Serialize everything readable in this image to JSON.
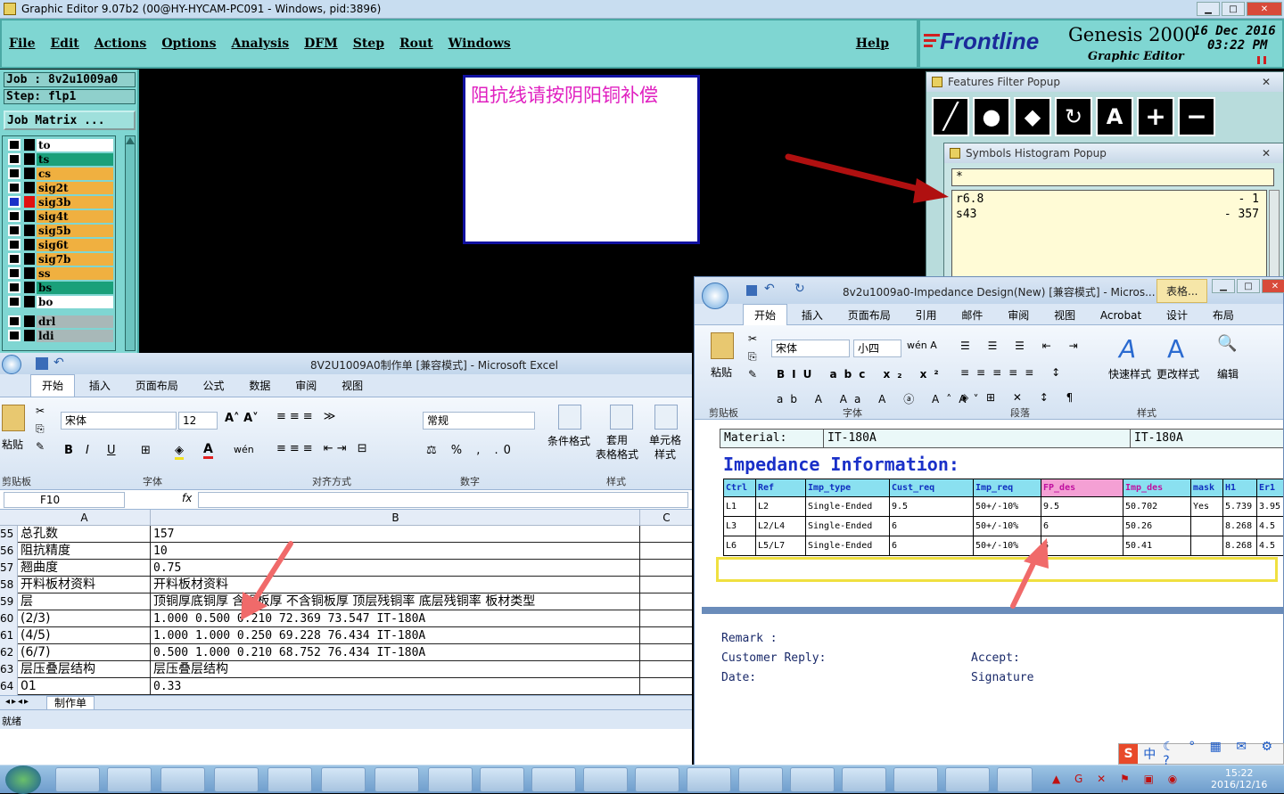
{
  "genesis": {
    "title": "Graphic Editor 9.07b2 (00@HY-HYCAM-PC091 - Windows, pid:3896)",
    "menu": [
      "File",
      "Edit",
      "Actions",
      "Options",
      "Analysis",
      "DFM",
      "Step",
      "Rout",
      "Windows"
    ],
    "help": "Help",
    "brand": "Frontline",
    "product": "Genesis 2000",
    "subtitle": "Graphic Editor",
    "date": "16 Dec 2016",
    "time": "03:22  PM",
    "job_label": "Job : 8v2u1009a0",
    "step_label": "Step: flp1",
    "job_matrix": "Job Matrix ...",
    "layers": [
      {
        "name": "to",
        "color": "c-w"
      },
      {
        "name": "ts",
        "color": "c-g"
      },
      {
        "name": "cs",
        "color": "c-o"
      },
      {
        "name": "sig2t",
        "color": "c-o"
      },
      {
        "name": "sig3b",
        "color": "c-o"
      },
      {
        "name": "sig4t",
        "color": "c-o"
      },
      {
        "name": "sig5b",
        "color": "c-o"
      },
      {
        "name": "sig6t",
        "color": "c-o"
      },
      {
        "name": "sig7b",
        "color": "c-o"
      },
      {
        "name": "ss",
        "color": "c-o"
      },
      {
        "name": "bs",
        "color": "c-g"
      },
      {
        "name": "bo",
        "color": "c-w"
      },
      {
        "name": "drl",
        "color": "c-gray"
      },
      {
        "name": "ldi",
        "color": "c-gray"
      }
    ],
    "note": "阻抗线请按阴阳铜补偿"
  },
  "features_popup": {
    "title": "Features Filter Popup"
  },
  "symbols_popup": {
    "title": "Symbols Histogram Popup",
    "filter": "*",
    "rows": [
      {
        "symbol": "r6.8",
        "count": "- 1"
      },
      {
        "symbol": "s43",
        "count": "- 357"
      }
    ]
  },
  "excel": {
    "title": "8V2U1009A0制作单 [兼容模式] - Microsoft Excel",
    "tabs": [
      "开始",
      "插入",
      "页面布局",
      "公式",
      "数据",
      "审阅",
      "视图"
    ],
    "font_name": "宋体",
    "font_size": "12",
    "number_format": "常规",
    "groups": [
      "剪贴板",
      "字体",
      "对齐方式",
      "数字",
      "样式"
    ],
    "paste": "粘贴",
    "cond_format": "条件格式",
    "table_format": "套用\n表格格式",
    "cell_style": "单元格\n样式",
    "cell_ref": "F10",
    "fx": "fx",
    "col_headers": [
      "A",
      "B",
      "C"
    ],
    "rows": [
      {
        "n": "55",
        "a": "总孔数",
        "b": "157"
      },
      {
        "n": "56",
        "a": "阻抗精度",
        "b": "10"
      },
      {
        "n": "57",
        "a": "翘曲度",
        "b": "0.75"
      },
      {
        "n": "58",
        "a": "开料板材资料",
        "b": "开料板材资料"
      },
      {
        "n": "59",
        "a": "层",
        "b": "顶铜厚底铜厚 含铜板厚 不含铜板厚 顶层残铜率 底层残铜率 板材类型"
      },
      {
        "n": "60",
        "a": "(2/3)",
        "b": "1.000  0.500          0.210     72.369    73.547      IT-180A"
      },
      {
        "n": "61",
        "a": "(4/5)",
        "b": "1.000  1.000          0.250     69.228    76.434      IT-180A"
      },
      {
        "n": "62",
        "a": "(6/7)",
        "b": "0.500  1.000          0.210     68.752    76.434      IT-180A"
      },
      {
        "n": "63",
        "a": "层压叠层结构",
        "b": "层压叠层结构"
      },
      {
        "n": "64",
        "a": "01",
        "b": "0.33"
      }
    ],
    "sheet_tab": "制作单",
    "status": "就绪"
  },
  "word": {
    "title": "8v2u1009a0-Impedance Design(New) [兼容模式] - Micros...",
    "extra_tab": "表格...",
    "tabs": [
      "开始",
      "插入",
      "页面布局",
      "引用",
      "邮件",
      "审阅",
      "视图",
      "Acrobat",
      "设计",
      "布局"
    ],
    "font_name": "宋体",
    "font_size": "小四",
    "groups": [
      "剪贴板",
      "字体",
      "段落",
      "样式"
    ],
    "paste": "粘贴",
    "quick_style": "快速样式",
    "change_style": "更改样式",
    "edit": "编辑",
    "material_label": "Material:",
    "material_1": "IT-180A",
    "material_2": "IT-180A",
    "heading": "Impedance Information:",
    "table_headers": [
      "Ctrl",
      "Ref",
      "Imp_type",
      "Cust_req",
      "Imp_req",
      "FP_des",
      "Imp_des",
      "mask",
      "H1",
      "Er1"
    ],
    "table_rows": [
      [
        "L1",
        "L2",
        "Single-Ended",
        "9.5",
        "50+/-10%",
        "9.5",
        "50.702",
        "Yes",
        "5.739",
        "3.95"
      ],
      [
        "L3",
        "L2/L4",
        "Single-Ended",
        "6",
        "50+/-10%",
        "6",
        "50.26",
        "",
        "8.268",
        "4.5"
      ],
      [
        "L6",
        "L5/L7",
        "Single-Ended",
        "6",
        "50+/-10%",
        "6",
        "50.41",
        "",
        "8.268",
        "4.5"
      ]
    ],
    "remark": "Remark :",
    "customer_reply": "Customer Reply:",
    "accept": "Accept:",
    "date": "Date:",
    "signature": "Signature"
  },
  "taskbar": {
    "ime": "中",
    "clock_time": "15:22",
    "clock_date": "2016/12/16"
  }
}
